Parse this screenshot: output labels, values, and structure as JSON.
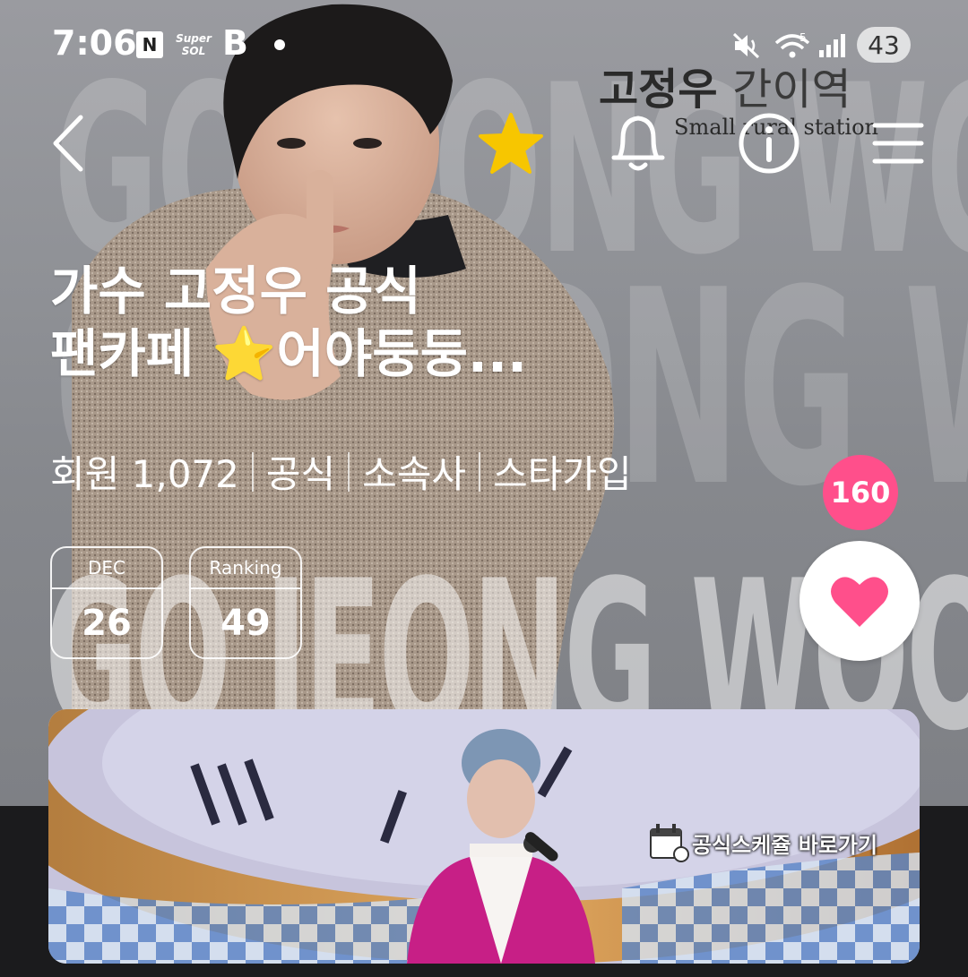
{
  "status_bar": {
    "time": "7:06",
    "naver_icon": "N",
    "supersol_top": "Super",
    "supersol_bottom": "SOL",
    "b_icon": "B",
    "battery": "43"
  },
  "brand": {
    "name_bold": "고정우",
    "name_light": "간이역",
    "subtitle": "Small rural station"
  },
  "watermark": {
    "line1": "GO JEONG WOO",
    "line2": "GO JEONG WOO",
    "line3": "GO JEONG WOO"
  },
  "nav": {
    "back": "back-icon",
    "favorite": "star-icon",
    "notifications": "bell-icon",
    "info": "info-icon",
    "menu": "menu-icon"
  },
  "cafe": {
    "title_line1": "가수 고정우 공식",
    "title_line2": "팬카페 ⭐어야둥둥...",
    "members": "회원 1,072",
    "tag_official": "공식",
    "tag_agency": "소속사",
    "tag_star": "스타가입"
  },
  "date_box": {
    "label": "DEC",
    "value": "26"
  },
  "ranking_box": {
    "label": "Ranking",
    "value": "49"
  },
  "likes": {
    "count": "160"
  },
  "banner": {
    "label": "공식스케쥴 바로가기"
  },
  "colors": {
    "accent_pink": "#ff4f8b",
    "star_yellow": "#f7c600",
    "dark_bg": "#1b1b1d"
  }
}
